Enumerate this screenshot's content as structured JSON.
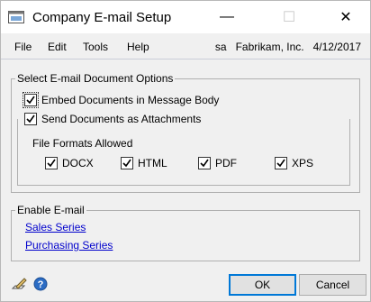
{
  "window": {
    "title": "Company E-mail Setup",
    "minimize": "—",
    "maximize": "☐",
    "close": "✕"
  },
  "menu": {
    "items": [
      "File",
      "Edit",
      "Tools",
      "Help"
    ],
    "user": "sa",
    "company": "Fabrikam, Inc.",
    "date": "4/12/2017"
  },
  "doc_options": {
    "label": "Select E-mail Document Options",
    "embed": {
      "label": "Embed Documents in Message Body",
      "checked": true
    },
    "attach": {
      "label": "Send Documents as Attachments",
      "checked": true
    },
    "formats_label": "File Formats Allowed",
    "formats": [
      {
        "label": "DOCX",
        "checked": true
      },
      {
        "label": "HTML",
        "checked": true
      },
      {
        "label": "PDF",
        "checked": true
      },
      {
        "label": "XPS",
        "checked": true
      }
    ]
  },
  "enable": {
    "label": "Enable E-mail",
    "links": [
      "Sales Series",
      "Purchasing Series"
    ]
  },
  "buttons": {
    "ok": "OK",
    "cancel": "Cancel"
  },
  "icons": {
    "footer": [
      "note-pencil-icon",
      "help-icon"
    ],
    "title": "gp-window-icon"
  }
}
